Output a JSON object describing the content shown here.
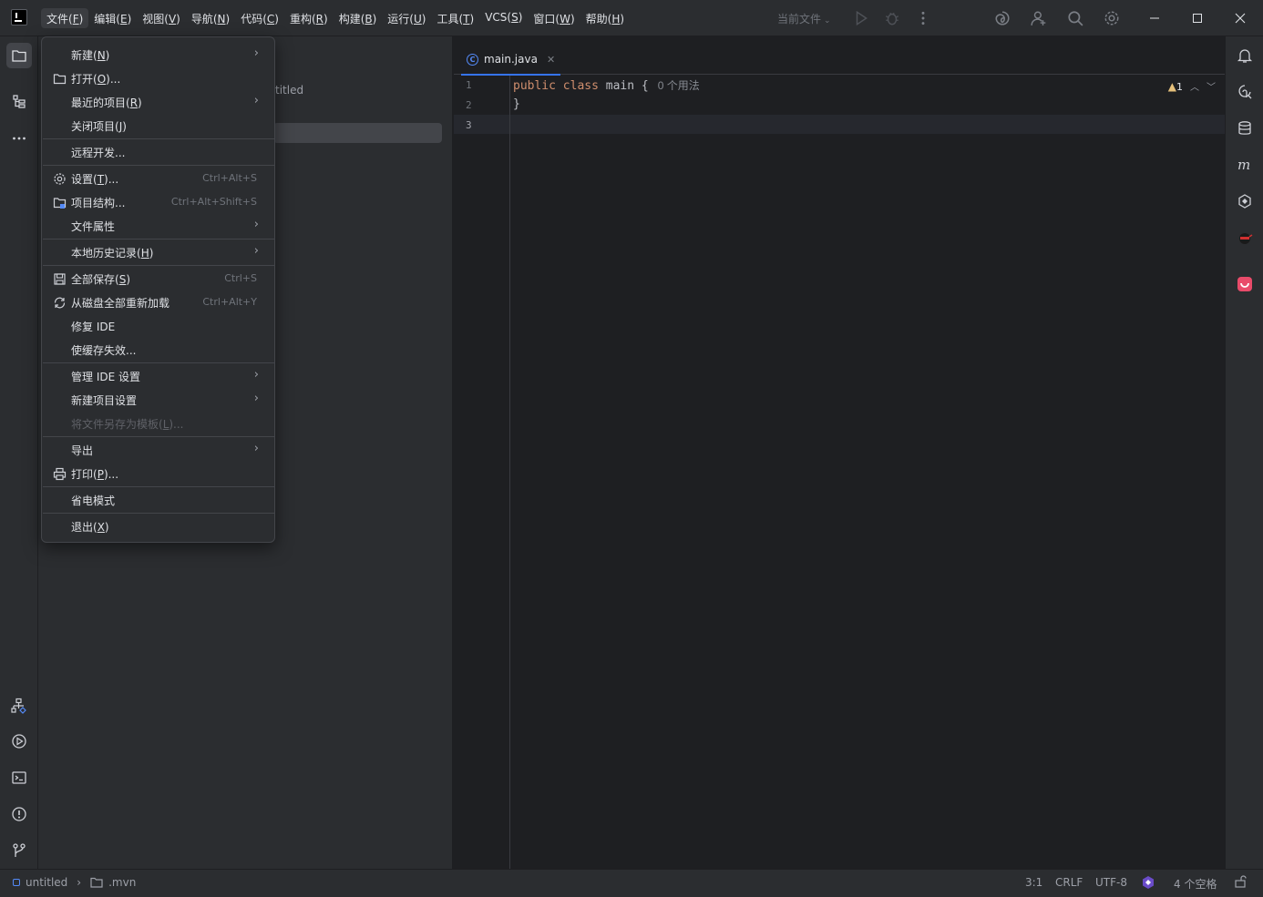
{
  "titlebar": {
    "menus": [
      {
        "label": "文件(",
        "mnemonic": "F",
        "tail": ")",
        "active": true
      },
      {
        "label": "编辑(",
        "mnemonic": "E",
        "tail": ")"
      },
      {
        "label": "视图(",
        "mnemonic": "V",
        "tail": ")"
      },
      {
        "label": "导航(",
        "mnemonic": "N",
        "tail": ")"
      },
      {
        "label": "代码(",
        "mnemonic": "C",
        "tail": ")"
      },
      {
        "label": "重构(",
        "mnemonic": "R",
        "tail": ")"
      },
      {
        "label": "构建(",
        "mnemonic": "B",
        "tail": ")"
      },
      {
        "label": "运行(",
        "mnemonic": "U",
        "tail": ")"
      },
      {
        "label": "工具(",
        "mnemonic": "T",
        "tail": ")"
      },
      {
        "label": "VCS(",
        "mnemonic": "S",
        "tail": ")"
      },
      {
        "label": "窗口(",
        "mnemonic": "W",
        "tail": ")"
      },
      {
        "label": "帮助(",
        "mnemonic": "H",
        "tail": ")"
      }
    ],
    "run_config": "当前文件"
  },
  "project_panel": {
    "root_label_fragment": "titled"
  },
  "editor": {
    "tab": {
      "label": "main.java",
      "icon": "class-icon",
      "icon_letter": "C"
    },
    "line_numbers": [
      "1",
      "2",
      "3"
    ],
    "code": {
      "kw_public": "public",
      "kw_class": "class",
      "class_name": "main",
      "open_brace": "{",
      "usage_hint": "0 个用法",
      "close_brace": "}"
    },
    "inspection": {
      "warnings": "1"
    }
  },
  "file_menu": {
    "items": [
      {
        "label": "新建(",
        "mn": "N",
        "tail": ")",
        "submenu": true
      },
      {
        "label": "打开(",
        "mn": "O",
        "tail": ")...",
        "icon": "folder-icon"
      },
      {
        "label": "最近的项目(",
        "mn": "R",
        "tail": ")",
        "submenu": true
      },
      {
        "label": "关闭项目(",
        "mn": "J",
        "tail": ")"
      },
      {
        "label": "远程开发..."
      },
      {
        "label": "设置(",
        "mn": "T",
        "tail": ")...",
        "icon": "gear-icon",
        "shortcut": "Ctrl+Alt+S"
      },
      {
        "label": "项目结构...",
        "icon": "project-structure-icon",
        "shortcut": "Ctrl+Alt+Shift+S"
      },
      {
        "label": "文件属性",
        "submenu": true
      },
      {
        "label": "本地历史记录(",
        "mn": "H",
        "tail": ")",
        "submenu": true
      },
      {
        "label": "全部保存(",
        "mn": "S",
        "tail": ")",
        "icon": "save-icon",
        "shortcut": "Ctrl+S"
      },
      {
        "label": "从磁盘全部重新加载",
        "icon": "reload-icon",
        "shortcut": "Ctrl+Alt+Y"
      },
      {
        "label": "修复 IDE"
      },
      {
        "label": "使缓存失效..."
      },
      {
        "label": "管理 IDE 设置",
        "submenu": true
      },
      {
        "label": "新建项目设置",
        "submenu": true
      },
      {
        "label": "将文件另存为模板(",
        "mn": "L",
        "tail": ")...",
        "disabled": true
      },
      {
        "label": "导出",
        "submenu": true
      },
      {
        "label": "打印(",
        "mn": "P",
        "tail": ")...",
        "icon": "print-icon"
      },
      {
        "label": "省电模式"
      },
      {
        "label": "退出(",
        "mn": "X",
        "tail": ")"
      }
    ]
  },
  "statusbar": {
    "project": "untitled",
    "folder": ".mvn",
    "caret": "3:1",
    "line_sep": "CRLF",
    "encoding": "UTF-8",
    "indent": "4 个空格"
  },
  "colors": {
    "background": "#1e1f22",
    "panel": "#2b2d30",
    "accent": "#3574f0",
    "keyword": "#cf8e6d",
    "warning": "#e5c07b"
  }
}
